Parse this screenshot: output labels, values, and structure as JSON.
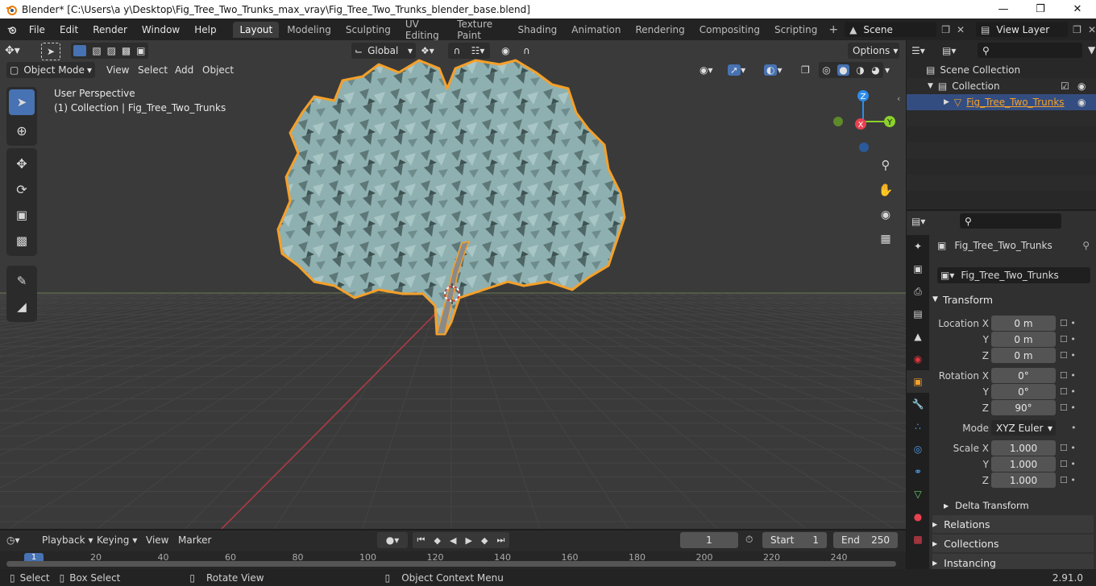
{
  "window": {
    "title": "Blender* [C:\\Users\\a y\\Desktop\\Fig_Tree_Two_Trunks_max_vray\\Fig_Tree_Two_Trunks_blender_base.blend]"
  },
  "menu": [
    "File",
    "Edit",
    "Render",
    "Window",
    "Help"
  ],
  "workspaces": [
    "Layout",
    "Modeling",
    "Sculpting",
    "UV Editing",
    "Texture Paint",
    "Shading",
    "Animation",
    "Rendering",
    "Compositing",
    "Scripting"
  ],
  "active_workspace": "Layout",
  "scene_name": "Scene",
  "view_layer": "View Layer",
  "viewport": {
    "orientation": "Global",
    "options": "Options",
    "mode": "Object Mode",
    "header_menus": [
      "View",
      "Select",
      "Add",
      "Object"
    ],
    "perspective": "User Perspective",
    "collection_info": "(1) Collection | Fig_Tree_Two_Trunks",
    "gizmo": {
      "z": "Z",
      "x": "X",
      "y": "Y"
    }
  },
  "outliner": {
    "scene_collection": "Scene Collection",
    "collection": "Collection",
    "object": "Fig_Tree_Two_Trunks"
  },
  "properties": {
    "object_name": "Fig_Tree_Two_Trunks",
    "data_name": "Fig_Tree_Two_Trunks",
    "transform_label": "Transform",
    "location_label": "Location X",
    "rotation_label": "Rotation X",
    "scale_label": "Scale X",
    "axis_y": "Y",
    "axis_z": "Z",
    "location": [
      "0 m",
      "0 m",
      "0 m"
    ],
    "rotation": [
      "0°",
      "0°",
      "90°"
    ],
    "mode_label": "Mode",
    "mode_value": "XYZ Euler",
    "scale": [
      "1.000",
      "1.000",
      "1.000"
    ],
    "delta_transform": "Delta Transform",
    "relations": "Relations",
    "collections": "Collections",
    "instancing": "Instancing"
  },
  "timeline": {
    "menus": [
      "Playback",
      "Keying",
      "View",
      "Marker"
    ],
    "current_frame": "1",
    "start_label": "Start",
    "start": "1",
    "end_label": "End",
    "end": "250",
    "ruler": [
      "20",
      "40",
      "60",
      "80",
      "100",
      "120",
      "140",
      "160",
      "180",
      "200",
      "220",
      "240"
    ],
    "cursor_frame": "1"
  },
  "status": {
    "select": "Select",
    "box_select": "Box Select",
    "rotate_view": "Rotate View",
    "context_menu": "Object Context Menu",
    "version": "2.91.0"
  },
  "colors": {
    "accent": "#4772b3",
    "selection_outline": "#f5a02a",
    "foliage": "#8fb0b0",
    "axis_x": "#e8414f",
    "axis_y": "#8bd12e",
    "axis_z": "#2d8ceb"
  }
}
